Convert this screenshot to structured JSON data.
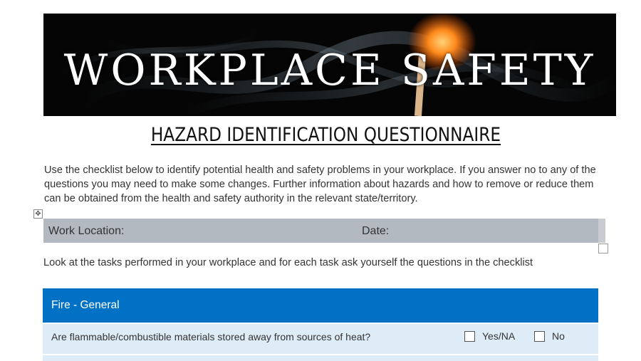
{
  "banner": {
    "title": "WORKPLACE SAFETY"
  },
  "document": {
    "title": "HAZARD IDENTIFICATION QUESTIONNAIRE",
    "intro": "Use the checklist below to identify potential health and safety problems in your workplace. If you answer no to any of the questions you may need to make some changes. Further information about hazards and how to remove or reduce them can be obtained from the health and safety authority in the relevant state/territory.",
    "work_location_label": "Work Location:",
    "date_label": "Date:",
    "instruction": "Look at the tasks performed in your workplace and for each task ask yourself the questions in the checklist"
  },
  "checklist": {
    "section_title": "Fire - General",
    "questions": [
      {
        "text": "Are flammable/combustible materials stored away from sources of heat?",
        "option_yes": "Yes/NA",
        "option_no": "No"
      }
    ]
  },
  "colors": {
    "section_header": "#0071c5",
    "question_row": "#deecf8",
    "location_row": "#b3b9c0"
  }
}
